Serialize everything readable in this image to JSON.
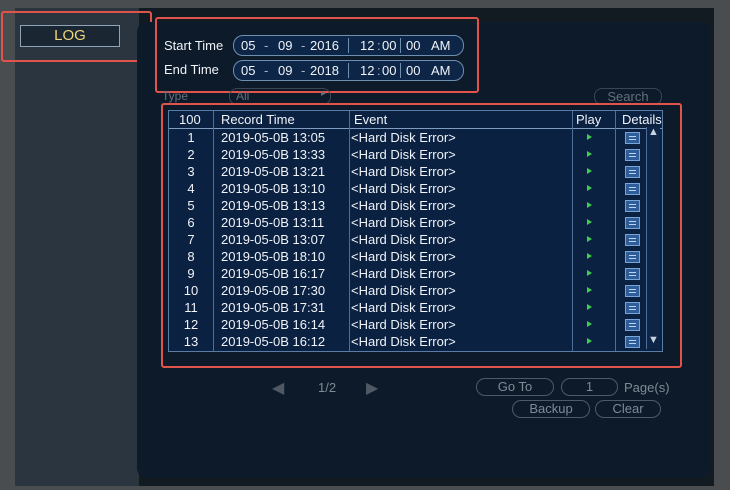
{
  "sidebar": {
    "log_tab": "LOG"
  },
  "filters": {
    "start_label": "Start Time",
    "end_label": "End Time",
    "start": {
      "month": "05",
      "day": "09",
      "year": "2016",
      "hour": "12",
      "minute": "00",
      "ampm": "AM"
    },
    "end": {
      "month": "05",
      "day": "09",
      "year": "2018",
      "hour": "12",
      "minute": "00",
      "ampm": "AM"
    },
    "type_label": "Type",
    "type_value": "All",
    "search_label": "Search"
  },
  "table": {
    "headers": {
      "index": "100",
      "time": "Record Time",
      "event": "Event",
      "play": "Play",
      "details": "Details"
    },
    "rows": [
      {
        "index": "1",
        "time": "2019-05-0B 13:05",
        "event": "<Hard Disk Error>"
      },
      {
        "index": "2",
        "time": "2019-05-0B 13:33",
        "event": "<Hard Disk Error>"
      },
      {
        "index": "3",
        "time": "2019-05-0B 13:21",
        "event": "<Hard Disk Error>"
      },
      {
        "index": "4",
        "time": "2019-05-0B 13:10",
        "event": "<Hard Disk Error>"
      },
      {
        "index": "5",
        "time": "2019-05-0B 13:13",
        "event": "<Hard Disk Error>"
      },
      {
        "index": "6",
        "time": "2019-05-0B 13:11",
        "event": "<Hard Disk Error>"
      },
      {
        "index": "7",
        "time": "2019-05-0B 13:07",
        "event": "<Hard Disk Error>"
      },
      {
        "index": "8",
        "time": "2019-05-0B 18:10",
        "event": "<Hard Disk Error>"
      },
      {
        "index": "9",
        "time": "2019-05-0B 16:17",
        "event": "<Hard Disk Error>"
      },
      {
        "index": "10",
        "time": "2019-05-0B 17:30",
        "event": "<Hard Disk Error>"
      },
      {
        "index": "11",
        "time": "2019-05-0B 17:31",
        "event": "<Hard Disk Error>"
      },
      {
        "index": "12",
        "time": "2019-05-0B 16:14",
        "event": "<Hard Disk Error>"
      },
      {
        "index": "13",
        "time": "2019-05-0B 16:12",
        "event": "<Hard Disk Error>"
      }
    ]
  },
  "pagination": {
    "page_indicator": "1/2",
    "goto_label": "Go To",
    "page_input": "1",
    "pages_label": "Page(s)",
    "backup_label": "Backup",
    "clear_label": "Clear"
  },
  "icons": {
    "prev": "prev-page-icon",
    "next": "next-page-icon",
    "play": "play-icon",
    "details": "details-icon",
    "scroll_up": "scroll-up-icon",
    "scroll_down": "scroll-down-icon",
    "dropdown": "chevron-right-icon"
  },
  "colors": {
    "highlight": "#e0544c",
    "log_tab_text": "#f0d67a",
    "play": "#3ecf4a"
  }
}
